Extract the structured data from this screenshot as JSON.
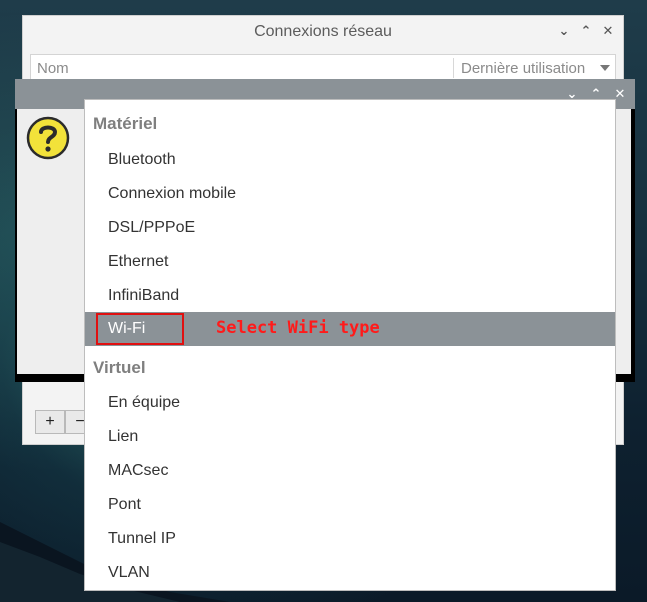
{
  "background_window": {
    "title": "Connexions réseau",
    "columns": {
      "name_header": "Nom",
      "last_used_header": "Dernière utilisation"
    },
    "buttons": {
      "add": "+",
      "remove": "−"
    }
  },
  "dialog": {
    "icon": "question-icon"
  },
  "menu": {
    "hardware_header": "Matériel",
    "hardware_items": [
      "Bluetooth",
      "Connexion mobile",
      "DSL/PPPoE",
      "Ethernet",
      "InfiniBand",
      "Wi-Fi"
    ],
    "virtual_header": "Virtuel",
    "virtual_items": [
      "En équipe",
      "Lien",
      "MACsec",
      "Pont",
      "Tunnel IP",
      "VLAN"
    ],
    "selected": "Wi-Fi"
  },
  "annotation": {
    "text": "Select WiFi type",
    "color": "#ff1a1a"
  },
  "colors": {
    "selection": "#8b9297",
    "titlebar": "#8b9297"
  }
}
